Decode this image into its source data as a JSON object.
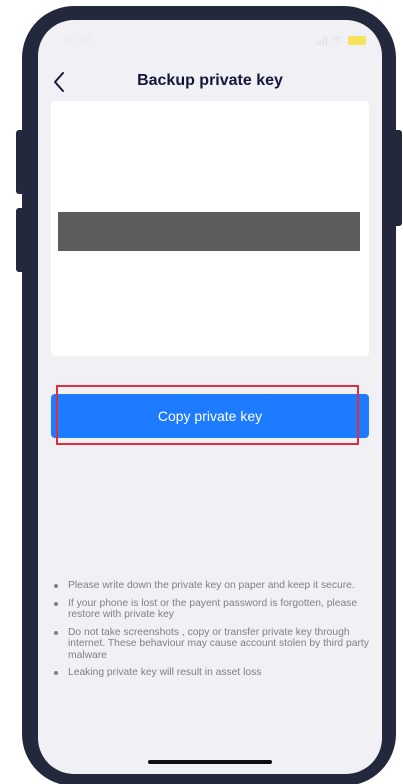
{
  "status_bar": {
    "time": "3:36"
  },
  "nav": {
    "title": "Backup private key",
    "back_icon": "chevron-left-icon"
  },
  "key_card": {
    "content": "redacted"
  },
  "copy_button": {
    "label": "Copy private key",
    "color": "#1c7bff"
  },
  "highlight_color": "#e12e3e",
  "notes": [
    "Please write down the private key on paper and keep it secure.",
    "If your phone is lost or the payent password is forgotten, please restore with private key",
    "Do not take screenshots , copy or transfer private key through internet. These behaviour may cause account stolen by third party malware",
    "Leaking private key will result in asset loss"
  ]
}
